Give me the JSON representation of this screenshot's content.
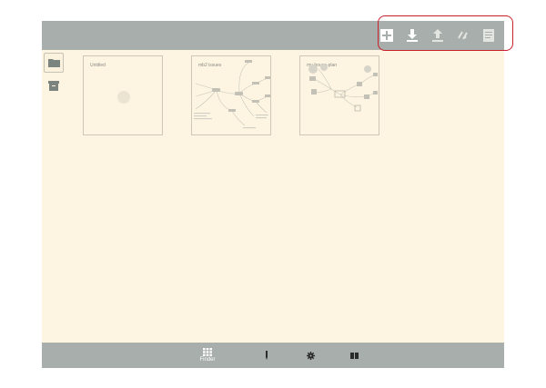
{
  "toolbar": {
    "items": [
      {
        "name": "new-map",
        "icon": "plus-box-icon"
      },
      {
        "name": "download",
        "icon": "download-icon"
      },
      {
        "name": "upload",
        "icon": "upload-icon"
      },
      {
        "name": "sync",
        "icon": "link-icon"
      },
      {
        "name": "export",
        "icon": "document-icon"
      }
    ]
  },
  "sidebar": {
    "items": [
      {
        "name": "folder",
        "icon": "folder-icon",
        "active": true
      },
      {
        "name": "archive",
        "icon": "archive-icon",
        "active": false
      }
    ]
  },
  "maps": [
    {
      "title": "Untitled"
    },
    {
      "title": "mb2 issues"
    },
    {
      "title": "my-house-plan"
    }
  ],
  "bottom_nav": {
    "finder_label": "Finder",
    "items": [
      {
        "name": "finder",
        "icon": "grid-icon"
      },
      {
        "name": "pen",
        "icon": "pen-icon"
      },
      {
        "name": "settings",
        "icon": "gear-icon"
      },
      {
        "name": "library",
        "icon": "book-icon"
      }
    ]
  },
  "colors": {
    "bar": "#a7aeab",
    "canvas": "#fdf5e2",
    "accent": "#c8202c"
  }
}
